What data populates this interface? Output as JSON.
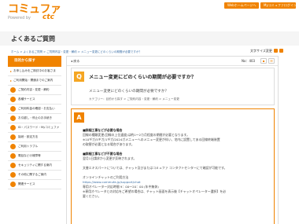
{
  "header": {
    "logo_text": "コミュファ",
    "logo_sub": "Powered by",
    "logo_brand": "ctc",
    "btn_web": "Webホームページへ",
    "btn_mypage": "Myコミュファログイン"
  },
  "page": {
    "title": "よくあるご質問",
    "breadcrumb": "ホーム > よくあるご質問 > ご質問内容・変更・解約 > メニュー変更にどのくらいの期間が必要ですか？",
    "print_label": "文字サイズ変更"
  },
  "sidebar": {
    "title": "目的から探す",
    "items": [
      {
        "label": "お申し込みをご検討中のお客さま",
        "icon": "arrow-icon"
      },
      {
        "label": "ご利用開始・開通までのご案内",
        "icon": "arrow-icon"
      },
      {
        "label": "ご契約内容・変更・解約",
        "icon": "document-icon"
      },
      {
        "label": "各種サービス",
        "icon": "service-icon"
      },
      {
        "label": "ご利用料金の確認・お支払い",
        "icon": "yen-icon"
      },
      {
        "label": "お引越し・停止のお手続き",
        "icon": "house-icon"
      },
      {
        "label": "ID・パスワード・Myコミュファ",
        "icon": "key-icon"
      },
      {
        "label": "接続・設定方法",
        "icon": "plug-icon"
      },
      {
        "label": "ご利用トラブル",
        "icon": "warning-icon"
      },
      {
        "label": "電話などの故障等",
        "icon": "phone-icon"
      },
      {
        "label": "セキュリティに関する案内",
        "icon": "lock-icon"
      },
      {
        "label": "その他に関するご案内",
        "icon": "info-icon"
      },
      {
        "label": "関連サービス",
        "icon": "link-icon"
      }
    ]
  },
  "toolbar": {
    "back": "戻る",
    "no_label": "No：403"
  },
  "question": {
    "badge": "Q",
    "title": "メニュー変更にどのくらいの期間が必要ですか？",
    "subtitle": "メニュー変更にどのくらいの期間が必要ですか？",
    "category": "カテゴリー：目的から探す > ご契約内容・変更・解約 > メニュー変更"
  },
  "answer": {
    "badge": "A",
    "lines": [
      {
        "text": "■詳細工事などが必要な場合",
        "bold": true
      },
      {
        "text": "回線の種類変更(回線の上位速度)は約1～2カ月程度の期間が必要となります。",
        "bold": false
      },
      {
        "text": "※10ギガ/5ギガ/1ギガ/2024ガメニューへのメニュー変更が伴い、宅内に設置してある回線終端装置",
        "bold": false
      },
      {
        "text": "の取替が必要となる場合があります。",
        "bold": false
      },
      {
        "text": "",
        "bold": false
      },
      {
        "text": "■詳細工事などが不要な場合",
        "bold": true
      },
      {
        "text": "翌月1日請求から変更が反映されます。",
        "bold": false
      },
      {
        "text": "",
        "bold": false
      },
      {
        "text": "文書エキスパートについては、チャット及びまたはコミュファ コンタクトセンターにて確認が可能です。",
        "bold": false
      },
      {
        "text": "",
        "bold": false
      },
      {
        "text": "オンラインチャットのご利用方法",
        "bold": false
      },
      {
        "text": "https://www.commufa.jp/support/chat",
        "bold": false,
        "link": true
      },
      {
        "text": "専用オペレーター対応時間 9：00～20：00 (年中無休)",
        "bold": false
      },
      {
        "text": "※専用オペレータとの対応をご希望の場合は、チャット画面を表示後【チャットオペレーター選択】を必",
        "bold": false
      },
      {
        "text": "要ください。",
        "bold": false
      }
    ]
  }
}
